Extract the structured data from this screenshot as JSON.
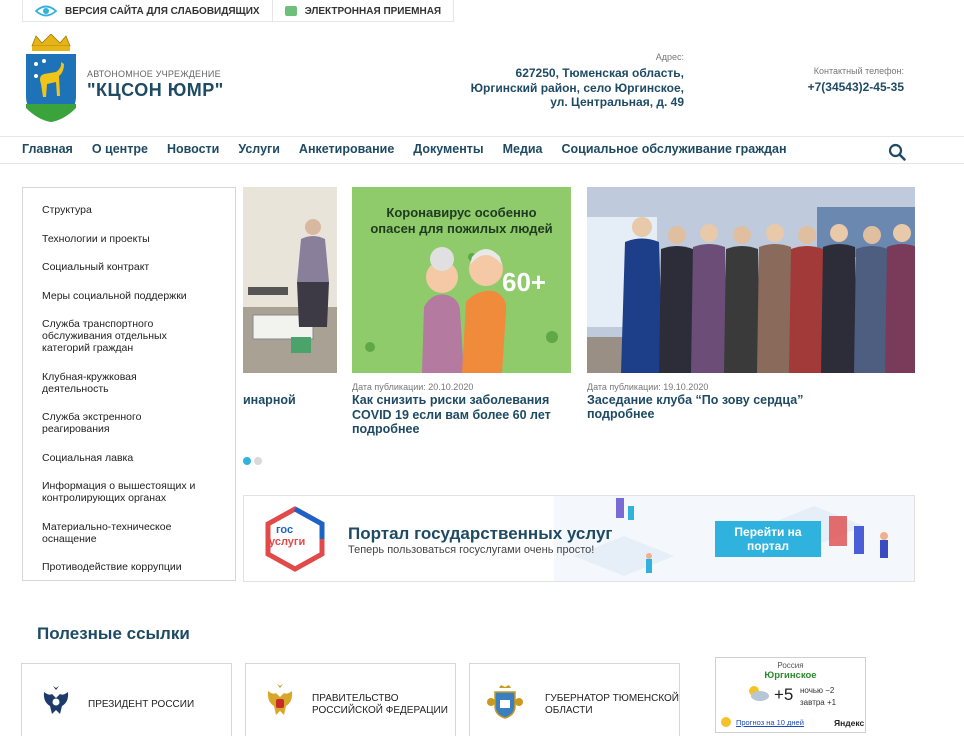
{
  "topbar": {
    "accessibility_label": "ВЕРСИЯ САЙТА ДЛЯ СЛАБОВИДЯЩИХ",
    "reception_label": "ЭЛЕКТРОННАЯ ПРИЕМНАЯ"
  },
  "header": {
    "org_subtitle": "АВТОНОМНОЕ УЧРЕЖДЕНИЕ",
    "org_name": "\"КЦСОН ЮМР\"",
    "address_label": "Адрес:",
    "address_lines": [
      "627250, Тюменская область,",
      "Юргинский район, село Юргинское,",
      "ул. Центральная, д. 49"
    ],
    "phone_label": "Контактный телефон:",
    "phone": "+7(34543)2-45-35"
  },
  "nav": {
    "items": [
      "Главная",
      "О центре",
      "Новости",
      "Услуги",
      "Анкетирование",
      "Документы",
      "Медиа",
      "Социальное обслуживание граждан"
    ]
  },
  "sidebar": {
    "items": [
      "Структура",
      "Технологии и проекты",
      "Социальный контракт",
      "Меры социальной поддержки",
      "Служба транспортного обслуживания отдельных категорий граждан",
      "Клубная-кружковая деятельность",
      "Служба экстренного реагирования",
      "Социальная лавка",
      "Информация о вышестоящих и контролирующих органах",
      "Материально-техническое оснащение",
      "Противодействие коррупции"
    ]
  },
  "news": {
    "partial_title": "инарной",
    "covid_poster_title": "Коронавирус особенно опасен для пожилых людей",
    "covid_poster_age": "60+",
    "items": [
      {
        "date": "Дата публикации: 20.10.2020",
        "title": "Как снизить риски заболевания COVID 19 если вам более 60 лет",
        "more": "подробнее"
      },
      {
        "date": "Дата публикации: 19.10.2020",
        "title": "Заседание клуба “По зову сердца”",
        "more": "подробнее"
      }
    ]
  },
  "gos_banner": {
    "logo_line1": "гос",
    "logo_line2": "услуги",
    "title": "Портал государственных услуг",
    "subtitle": "Теперь пользоваться госуслугами очень просто!",
    "button": "Перейти на портал"
  },
  "useful_links": {
    "title": "Полезные ссылки",
    "cards": [
      "ПРЕЗИДЕНТ РОССИИ",
      "ПРАВИТЕЛЬСТВО РОССИЙСКОЙ ФЕДЕРАЦИИ",
      "ГУБЕРНАТОР ТЮМЕНСКОЙ ОБЛАСТИ"
    ]
  },
  "weather": {
    "country": "Россия",
    "city": "Юргинское",
    "temp": "+5",
    "night": "ночью −2",
    "tomorrow": "завтра +1",
    "forecast_link": "Прогноз на 10 дней",
    "provider": "Яндекс"
  },
  "colors": {
    "brand": "#1e4a64",
    "accent": "#2fb2dd",
    "green": "#6dc07a"
  }
}
